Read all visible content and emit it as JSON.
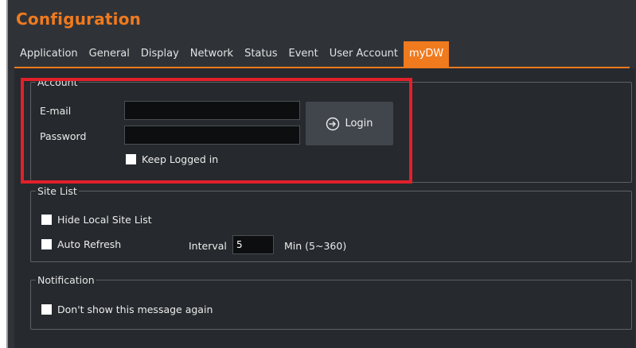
{
  "window": {
    "title": "Configuration"
  },
  "tabs": [
    {
      "label": "Application"
    },
    {
      "label": "General"
    },
    {
      "label": "Display"
    },
    {
      "label": "Network"
    },
    {
      "label": "Status"
    },
    {
      "label": "Event"
    },
    {
      "label": "User Account"
    },
    {
      "label": "myDW",
      "active": true
    }
  ],
  "account": {
    "legend": "Account",
    "email_label": "E-mail",
    "email_value": "",
    "password_label": "Password",
    "password_value": "",
    "login_label": "Login",
    "login_icon": "login-arrow-icon",
    "keep_logged_label": "Keep Logged in",
    "keep_logged_checked": false
  },
  "site_list": {
    "legend": "Site List",
    "hide_local_label": "Hide Local Site List",
    "hide_local_checked": false,
    "auto_refresh_label": "Auto Refresh",
    "auto_refresh_checked": false,
    "interval_label": "Interval",
    "interval_value": "5",
    "interval_unit": "Min (5~360)"
  },
  "notification": {
    "legend": "Notification",
    "dont_show_label": "Don't show this message again",
    "dont_show_checked": false
  },
  "colors": {
    "accent": "#f07a1e",
    "highlight": "#e2202a",
    "window_bg": "#2f3338",
    "panel_bg": "#26292d"
  }
}
